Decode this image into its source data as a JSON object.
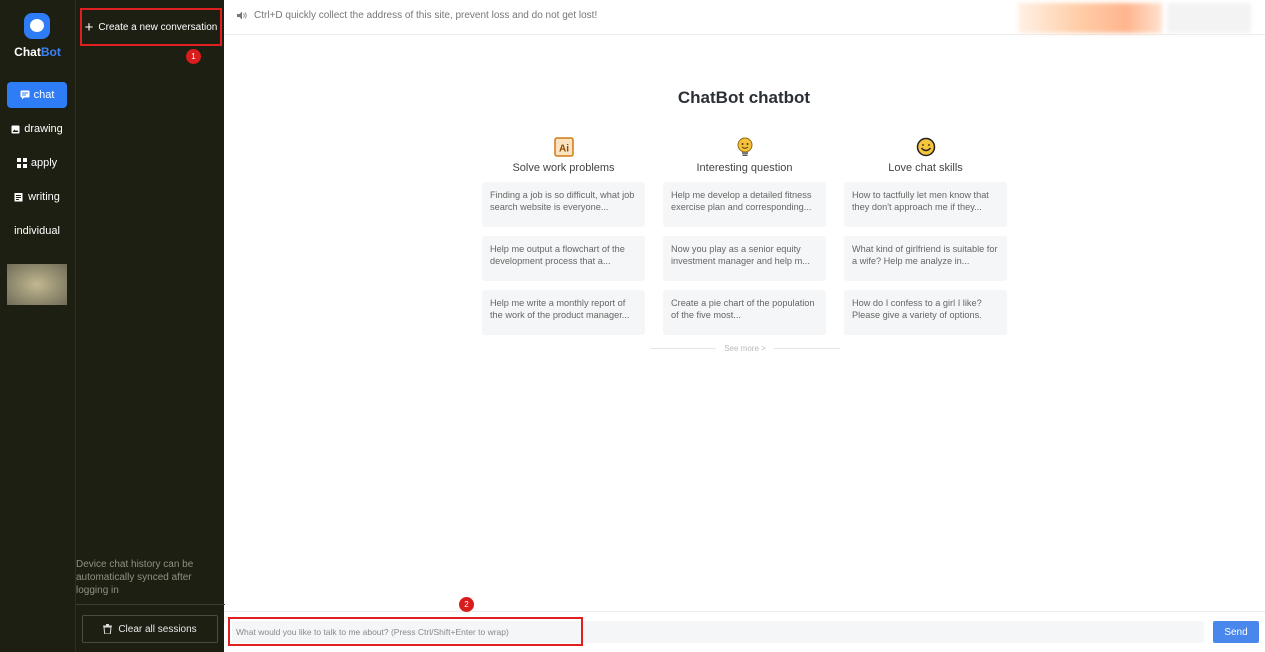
{
  "brand": {
    "name_part1": "Chat",
    "name_part2": "Bot",
    "accent_color": "#2e7cf6"
  },
  "rail": {
    "items": [
      {
        "label": "chat",
        "icon": "chat-icon",
        "active": true
      },
      {
        "label": "drawing",
        "icon": "image-icon",
        "active": false
      },
      {
        "label": "apply",
        "icon": "grid-icon",
        "active": false
      },
      {
        "label": "writing",
        "icon": "edit-icon",
        "active": false
      },
      {
        "label": "individual",
        "icon": "",
        "active": false
      }
    ]
  },
  "sidebar": {
    "new_conversation": "Create a new conversation",
    "badge_1": "1",
    "sync_note": "Device chat history can be automatically synced after logging in",
    "clear_all": "Clear all sessions"
  },
  "topbar": {
    "notice": "Ctrl+D quickly collect the address of this site, prevent loss and do not get lost!"
  },
  "main": {
    "title": "ChatBot chatbot",
    "columns": [
      {
        "label": "Solve work problems",
        "icon": "ai-icon",
        "cards": [
          "Finding a job is so difficult, what job search website is everyone...",
          "Help me output a flowchart of the development process that a...",
          "Help me write a monthly report of the work of the product manager..."
        ]
      },
      {
        "label": "Interesting question",
        "icon": "lightbulb-icon",
        "cards": [
          "Help me develop a detailed fitness exercise plan and corresponding...",
          "Now you play as a senior equity investment manager and help m...",
          "Create a pie chart of the population of the five most..."
        ]
      },
      {
        "label": "Love chat skills",
        "icon": "smiley-icon",
        "cards": [
          "How to tactfully let men know that they don't approach me if they...",
          "What kind of girlfriend is suitable for a wife? Help me analyze in...",
          "How do I confess to a girl I like? Please give a variety of options."
        ]
      }
    ],
    "see_more": "See more >"
  },
  "input": {
    "placeholder": "What would you like to talk to me about? (Press Ctrl/Shift+Enter to wrap)",
    "badge_2": "2",
    "send": "Send"
  }
}
